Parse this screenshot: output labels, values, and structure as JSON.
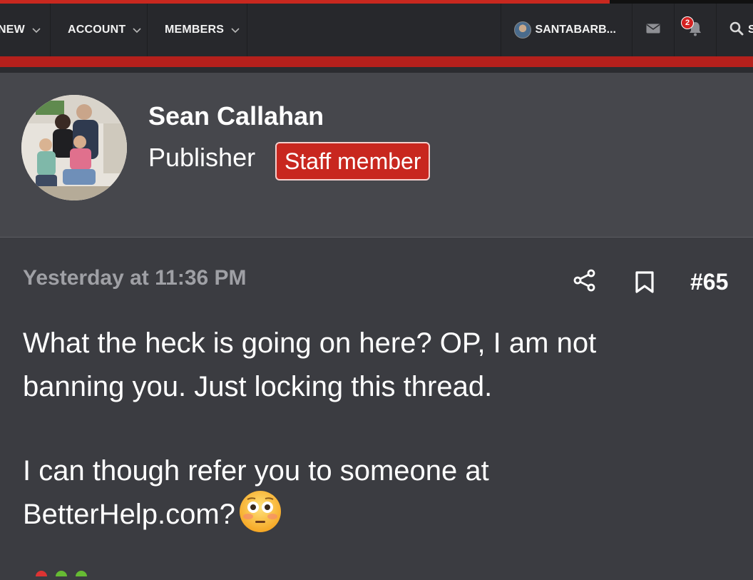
{
  "nav": {
    "items": [
      {
        "label": "NEW"
      },
      {
        "label": "ACCOUNT"
      },
      {
        "label": "MEMBERS"
      }
    ],
    "user": {
      "name": "SANTABARB..."
    },
    "notifications_count": "2",
    "search_label": "S",
    "icons": [
      "chevron-down-icon",
      "envelope-icon",
      "bell-icon",
      "search-icon"
    ]
  },
  "post": {
    "author": {
      "name": "Sean Callahan",
      "title": "Publisher",
      "badge": "Staff member"
    },
    "timestamp": "Yesterday at 11:36 PM",
    "post_number": "#65",
    "paragraphs": [
      {
        "lines": [
          "What the heck is going on here? OP, I am not",
          "banning you. Just locking this thread."
        ]
      },
      {
        "lines": [
          "I can though refer you to someone at",
          "BetterHelp.com?"
        ]
      }
    ],
    "emoji": "flushed-face"
  },
  "colors": {
    "accent_red": "#c8271f",
    "navbar_bg": "#27282c",
    "panel_bg": "#46474c",
    "post_bg": "#3b3c41",
    "date_text": "#9fa0a5"
  }
}
